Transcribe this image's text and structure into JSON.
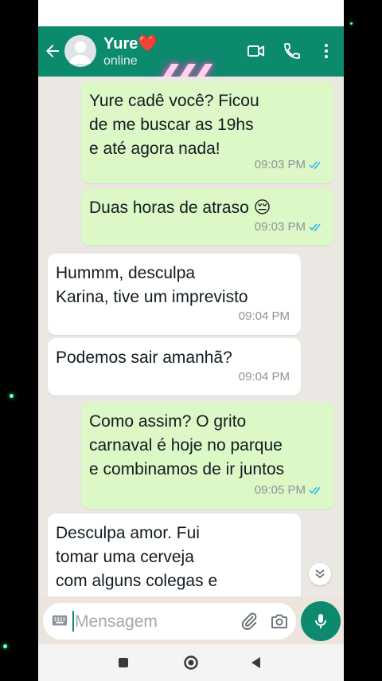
{
  "contact": {
    "name": "Yure❤️",
    "status": "online"
  },
  "header_icons": [
    "back-arrow-icon",
    "video-call-icon",
    "voice-call-icon",
    "more-options-icon"
  ],
  "messages": [
    {
      "direction": "outgoing",
      "text": "Yure cadê você? Ficou\nde me buscar as 19hs\ne até agora nada!",
      "time": "09:03 PM",
      "read": true
    },
    {
      "direction": "outgoing",
      "text": "Duas horas de atraso 😔",
      "time": "09:03 PM",
      "read": true
    },
    {
      "direction": "incoming",
      "text": "Hummm, desculpa\nKarina, tive um imprevisto",
      "time": "09:04 PM"
    },
    {
      "direction": "incoming",
      "text": "Podemos sair amanhã?",
      "time": "09:04 PM"
    },
    {
      "direction": "outgoing",
      "text": "Como assim? O grito\ncarnaval é hoje no parque\ne combinamos de ir juntos",
      "time": "09:05 PM",
      "read": true
    },
    {
      "direction": "incoming",
      "text": "Desculpa amor. Fui\ntomar uma cerveja\ncom alguns colegas e\nacabei esquecendo de"
    }
  ],
  "composer": {
    "placeholder": "Mensagem"
  },
  "colors": {
    "header": "#0b8a6e",
    "outgoing_bubble": "#dcf8c6",
    "incoming_bubble": "#ffffff",
    "read_ticks": "#34b7f1"
  }
}
